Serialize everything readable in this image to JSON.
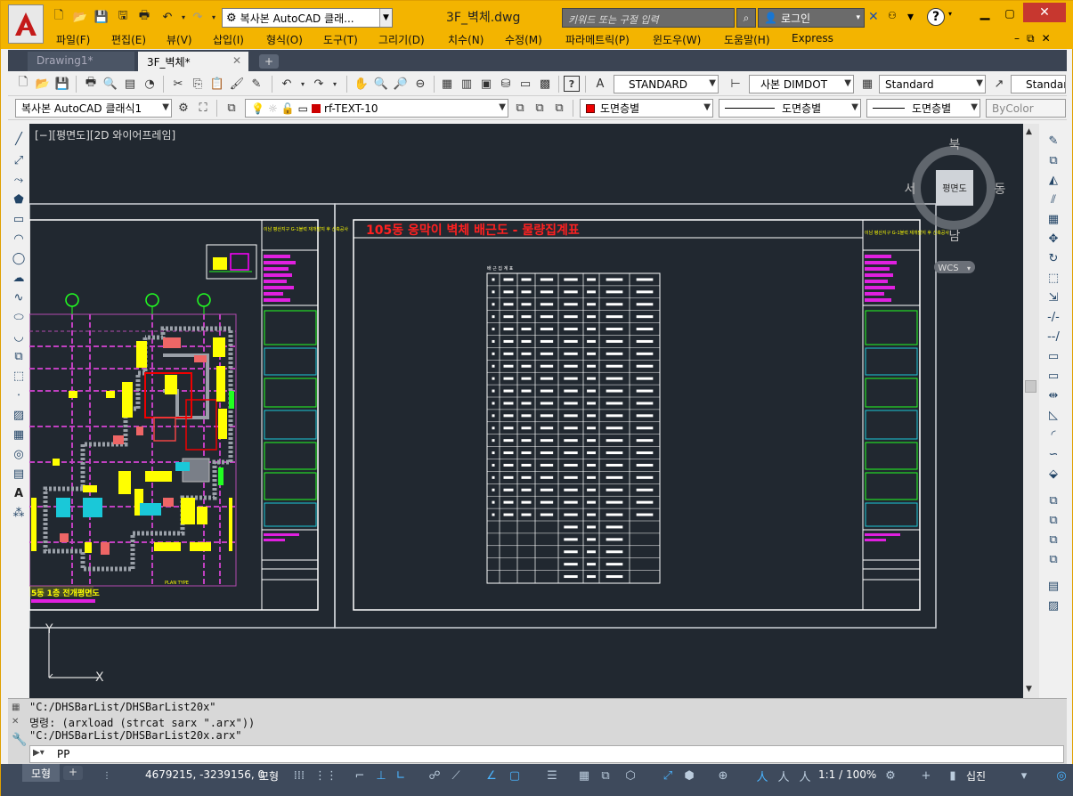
{
  "titlebar": {
    "workspace": "복사본 AutoCAD 클래...",
    "doc_title": "3F_벽체.dwg",
    "search_placeholder": "키워드 또는 구절 입력",
    "login": "로그인"
  },
  "menu": [
    "파일(F)",
    "편집(E)",
    "뷰(V)",
    "삽입(I)",
    "형식(O)",
    "도구(T)",
    "그리기(D)",
    "치수(N)",
    "수정(M)",
    "파라메트릭(P)",
    "윈도우(W)",
    "도움말(H)",
    "Express"
  ],
  "tabs": [
    {
      "label": "Drawing1*"
    },
    {
      "label": "3F_벽체*"
    }
  ],
  "toolbar1": {
    "text_style": "STANDARD",
    "dim_style": "사본 DIMDOT",
    "table_style": "Standard",
    "mleader_style": "Standard"
  },
  "toolbar2": {
    "workspace": "복사본 AutoCAD 클래식1",
    "layer": "rf-TEXT-10",
    "color": "도면층별",
    "linetype": "도면층별",
    "lineweight": "도면층별",
    "plotstyle": "ByColor"
  },
  "viewport": {
    "label": "[−][평면도][2D 와이어프레임]"
  },
  "viewcube": {
    "north": "북",
    "south": "남",
    "east": "동",
    "west": "서",
    "face": "평면도",
    "wcs": "WCS"
  },
  "drawing": {
    "sheet_title": "105동 옹막이 벽체 배근도 - 물량집계표",
    "plan_title": "5동 1층 전개평면도",
    "table_header": "배 근 집 계 표",
    "title_block_left": "이남 평산지구 G-1블럭 재개발지 후 신축공사",
    "title_block_right": "이남 평산지구 G-1블럭 재개발지 후 신축공사"
  },
  "command": {
    "history": [
      "\"C:/DHSBarList/DHSBarList20x\"",
      "명령: (arxload (strcat sarx \".arx\"))",
      "\"C:/DHSBarList/DHSBarList20x.arx\""
    ],
    "input": "PP"
  },
  "status": {
    "model_tab": "모형",
    "coords": "4679215, -3239156, 0",
    "model": "모형",
    "scale": "1:1 / 100%",
    "units": "십진"
  },
  "colors": {
    "title_accent": "#f3b400",
    "drawing_bg": "#212830",
    "status_bg": "#3e4a5c"
  }
}
